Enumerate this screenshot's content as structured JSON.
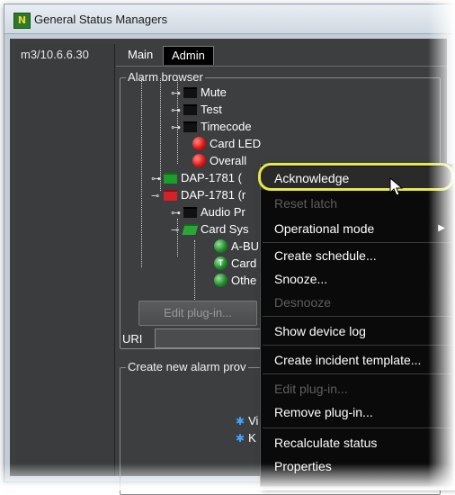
{
  "window": {
    "title": "General Status Managers",
    "app_icon_text": "N"
  },
  "host": {
    "label": "m3/10.6.6.30"
  },
  "tabs": [
    {
      "label": "Main"
    },
    {
      "label": "Admin"
    }
  ],
  "alarm_browser": {
    "title": "Alarm browser",
    "tree": [
      {
        "label": "Mute",
        "icon": "folder-black",
        "toggle": true
      },
      {
        "label": "Test",
        "icon": "folder-black",
        "toggle": true
      },
      {
        "label": "Timecode",
        "icon": "folder-black",
        "toggle": true
      },
      {
        "label": "Card LED",
        "icon": "red-dot"
      },
      {
        "label": "Overall",
        "icon": "red-dot"
      },
      {
        "label": "DAP-1781 (",
        "icon": "folder-green",
        "toggle": true
      },
      {
        "label": "DAP-1781 (r",
        "icon": "folder-red",
        "toggle": true,
        "expanded": true
      },
      {
        "label": "Audio Pr",
        "icon": "folder-black",
        "toggle": true
      },
      {
        "label": "Card Sys",
        "icon": "folder-green-open",
        "toggle": true,
        "expanded": true
      },
      {
        "label": "A-BU",
        "icon": "green-dot"
      },
      {
        "label": "Card",
        "icon": "green-dot-t",
        "glyph": "T"
      },
      {
        "label": "Othe",
        "icon": "green-dot"
      }
    ],
    "edit_plugin_label": "Edit plug-in...",
    "uri_label": "URI"
  },
  "create_provider": {
    "title": "Create new alarm prov",
    "items": [
      {
        "label": "Vi"
      },
      {
        "label": "K"
      }
    ]
  },
  "context_menu": {
    "items": [
      {
        "label": "Acknowledge",
        "enabled": true,
        "highlighted": true
      },
      {
        "label": "Reset latch",
        "enabled": false
      },
      {
        "label": "Operational mode",
        "enabled": true,
        "submenu": true
      },
      {
        "label": "Create schedule...",
        "enabled": true
      },
      {
        "label": "Snooze...",
        "enabled": true
      },
      {
        "label": "Desnooze",
        "enabled": false
      },
      {
        "label": "Show device log",
        "enabled": true
      },
      {
        "label": "Create incident template...",
        "enabled": true
      },
      {
        "label": "Edit plug-in...",
        "enabled": false
      },
      {
        "label": "Remove plug-in...",
        "enabled": true
      },
      {
        "label": "Recalculate status",
        "enabled": true
      },
      {
        "label": "Properties",
        "enabled": true
      }
    ]
  },
  "colors": {
    "panel_bg": "#3c3e40",
    "menu_bg": "#0a0a0a",
    "highlight_ring": "#e8e84a"
  }
}
